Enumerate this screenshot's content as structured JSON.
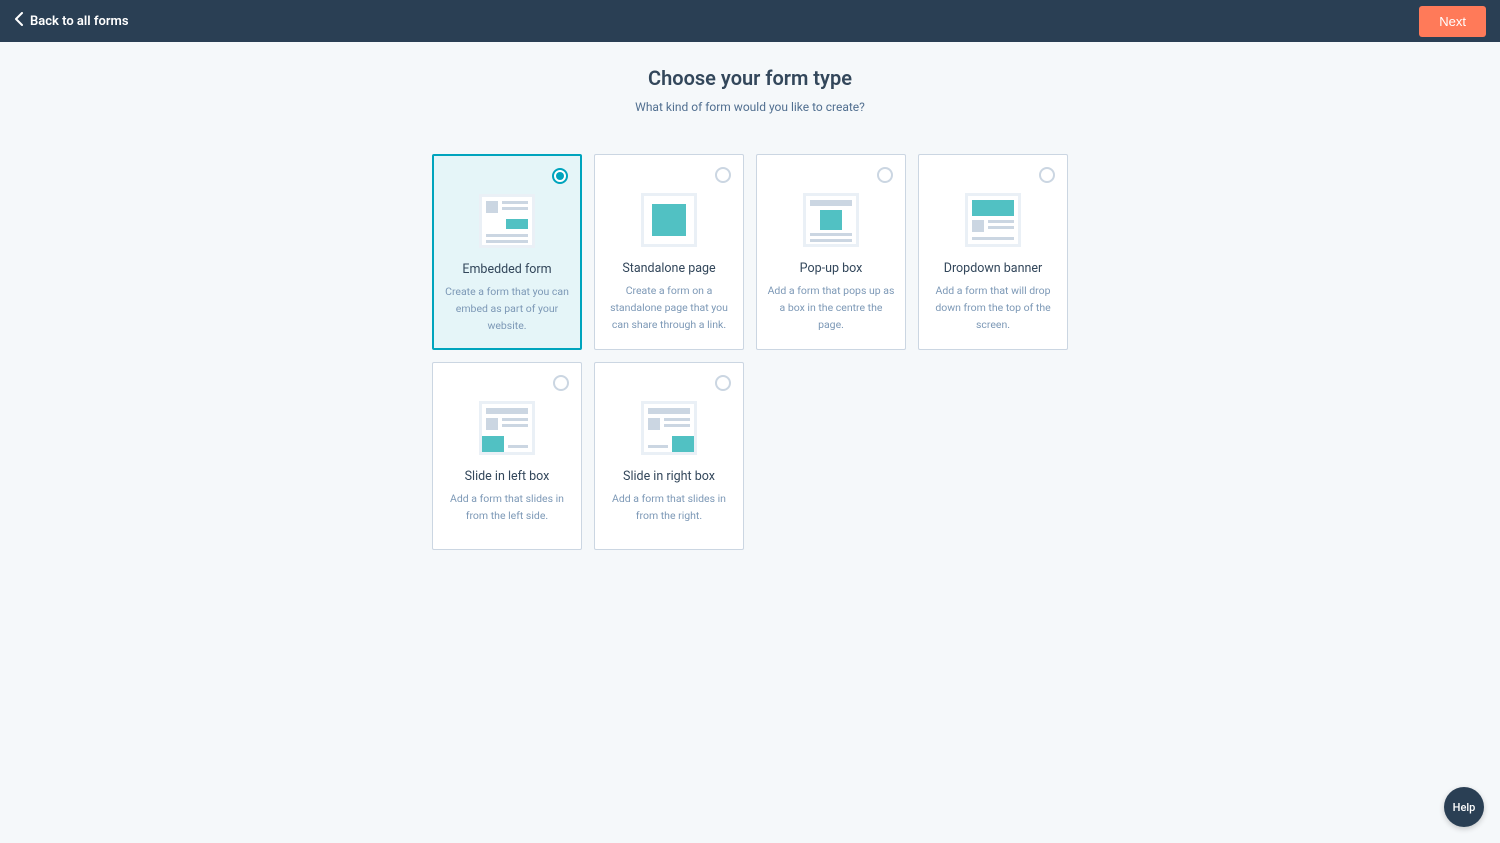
{
  "topbar": {
    "back_label": "Back to all forms",
    "next_label": "Next"
  },
  "page": {
    "title": "Choose your form type",
    "subtitle": "What kind of form would you like to create?"
  },
  "cards": [
    {
      "key": "embedded",
      "title": "Embedded form",
      "desc": "Create a form that you can embed as part of your website.",
      "selected": true
    },
    {
      "key": "standalone",
      "title": "Standalone page",
      "desc": "Create a form on a standalone page that you can share through a link.",
      "selected": false
    },
    {
      "key": "popup",
      "title": "Pop-up box",
      "desc": "Add a form that pops up as a box in the centre the page.",
      "selected": false
    },
    {
      "key": "dropdown",
      "title": "Dropdown banner",
      "desc": "Add a form that will drop down from the top of the screen.",
      "selected": false
    },
    {
      "key": "slideleft",
      "title": "Slide in left box",
      "desc": "Add a form that slides in from the left side.",
      "selected": false
    },
    {
      "key": "slideright",
      "title": "Slide in right box",
      "desc": "Add a form that slides in from the right.",
      "selected": false
    }
  ],
  "help": {
    "label": "Help"
  }
}
